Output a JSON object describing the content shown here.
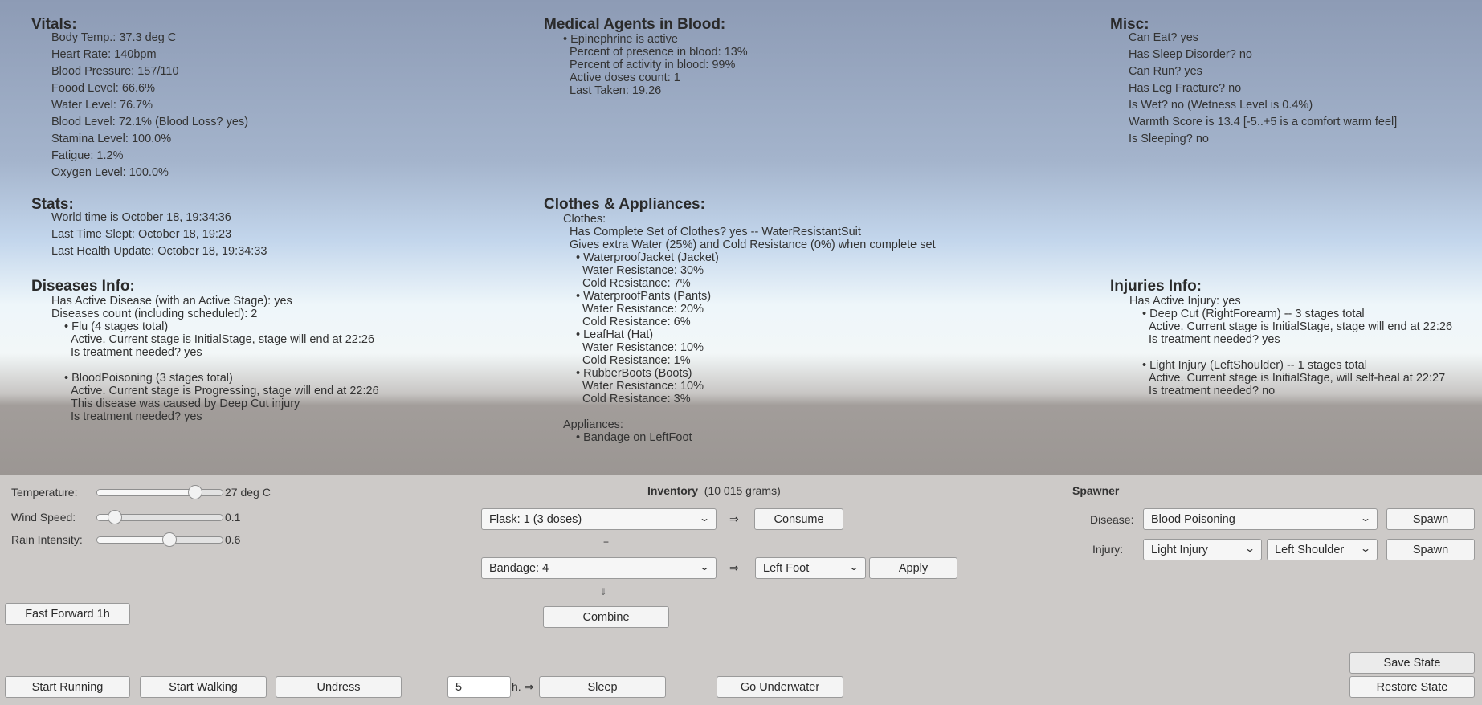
{
  "vitals": {
    "title": "Vitals:",
    "items": [
      "Body Temp.: 37.3 deg C",
      "Heart Rate: 140bpm",
      "Blood Pressure: 157/110",
      "Foood Level: 66.6%",
      "Water Level: 76.7%",
      "Blood Level: 72.1% (Blood Loss? yes)",
      "Stamina Level: 100.0%",
      "Fatigue: 1.2%",
      "Oxygen Level: 100.0%"
    ]
  },
  "stats": {
    "title": "Stats:",
    "items": [
      "World time is October 18, 19:34:36",
      "Last Time Slept: October 18, 19:23",
      "Last Health Update: October 18, 19:34:33"
    ]
  },
  "diseases": {
    "title": "Diseases Info:",
    "lines": [
      "Has Active Disease (with an Active Stage): yes",
      "Diseases count (including scheduled): 2"
    ],
    "entries": [
      {
        "name": "• Flu (4 stages total)",
        "lines": [
          "Active. Current stage is InitialStage, stage will end at 22:26",
          "Is treatment needed? yes"
        ]
      },
      {
        "name": "• BloodPoisoning (3 stages total)",
        "lines": [
          "Active. Current stage is Progressing, stage will end at 22:26",
          "This disease was caused by Deep Cut injury",
          "Is treatment needed? yes"
        ]
      }
    ]
  },
  "medical": {
    "title": "Medical Agents in Blood:",
    "agent": "• Epinephrine is active",
    "lines": [
      "Percent of presence in blood: 13%",
      "Percent of activity in blood: 99%",
      "Active doses count: 1",
      "Last Taken: 19.26"
    ]
  },
  "clothes": {
    "title": "Clothes & Appliances:",
    "clothes_label": "Clothes:",
    "lines": [
      "Has Complete Set of Clothes? yes -- WaterResistantSuit",
      "Gives extra Water (25%) and Cold Resistance (0%) when complete set"
    ],
    "items": [
      {
        "name": "• WaterproofJacket (Jacket)",
        "water": "Water Resistance: 30%",
        "cold": "Cold Resistance: 7%"
      },
      {
        "name": "• WaterproofPants (Pants)",
        "water": "Water Resistance: 20%",
        "cold": "Cold Resistance: 6%"
      },
      {
        "name": "• LeafHat (Hat)",
        "water": "Water Resistance: 10%",
        "cold": "Cold Resistance: 1%"
      },
      {
        "name": "• RubberBoots (Boots)",
        "water": "Water Resistance: 10%",
        "cold": "Cold Resistance: 3%"
      }
    ],
    "appliances_label": "Appliances:",
    "appliances": [
      "• Bandage on LeftFoot"
    ]
  },
  "misc": {
    "title": "Misc:",
    "items": [
      "Can Eat? yes",
      "Has Sleep Disorder? no",
      "Can Run? yes",
      "Has Leg Fracture? no",
      "Is Wet? no (Wetness Level is 0.4%)",
      "Warmth Score is 13.4 [-5..+5 is a comfort warm feel]",
      "Is Sleeping? no"
    ]
  },
  "injuries": {
    "title": "Injuries Info:",
    "line": "Has Active Injury: yes",
    "entries": [
      {
        "name": "• Deep Cut (RightForearm) -- 3 stages total",
        "lines": [
          "Active. Current stage is InitialStage, stage will end at 22:26",
          "Is treatment needed? yes"
        ]
      },
      {
        "name": "• Light Injury (LeftShoulder) -- 1 stages total",
        "lines": [
          "Active. Current stage is InitialStage, will self-heal at 22:27",
          "Is treatment needed? no"
        ]
      }
    ]
  },
  "controls": {
    "sliders": [
      {
        "label": "Temperature:",
        "value_text": "27 deg C",
        "fraction": 0.78
      },
      {
        "label": "Wind Speed:",
        "value_text": "0.1",
        "fraction": 0.14
      },
      {
        "label": "Rain Intensity:",
        "value_text": "0.6",
        "fraction": 0.58
      }
    ],
    "fast_forward": "Fast Forward 1h",
    "start_running": "Start Running",
    "start_walking": "Start Walking",
    "undress": "Undress",
    "sleep_hours": "5",
    "sleep_suffix": "h. ⇒",
    "sleep": "Sleep",
    "go_underwater": "Go Underwater",
    "save_state": "Save State",
    "restore_state": "Restore State"
  },
  "inventory": {
    "title": "Inventory",
    "weight": "(10 015 grams)",
    "item1": "Flask: 1 (3 doses)",
    "item2": "Bandage: 4",
    "arrow": "⇒",
    "plus": "+",
    "down_arrow": "⇓",
    "consume": "Consume",
    "body_part": "Left Foot",
    "apply": "Apply",
    "combine": "Combine"
  },
  "spawner": {
    "title": "Spawner",
    "disease_label": "Disease:",
    "disease_value": "Blood Poisoning",
    "injury_label": "Injury:",
    "injury_value": "Light Injury",
    "injury_part": "Left Shoulder",
    "spawn": "Spawn"
  }
}
